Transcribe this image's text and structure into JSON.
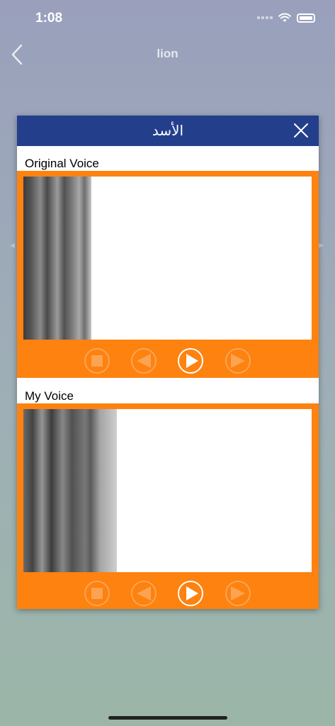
{
  "status_bar": {
    "time": "1:08"
  },
  "nav": {
    "title": "lion"
  },
  "dialog": {
    "title": "الأسد",
    "sections": [
      {
        "label": "Original Voice"
      },
      {
        "label": "My Voice"
      }
    ]
  },
  "colors": {
    "header": "#233f8c",
    "panel": "#fd8210",
    "background_top": "#9aa0bc",
    "background_bottom": "#9bb6a8"
  },
  "icons": {
    "controls": [
      "stop-icon",
      "rewind-icon",
      "play-icon",
      "forward-icon"
    ],
    "states": [
      "disabled",
      "disabled",
      "enabled",
      "disabled"
    ]
  }
}
